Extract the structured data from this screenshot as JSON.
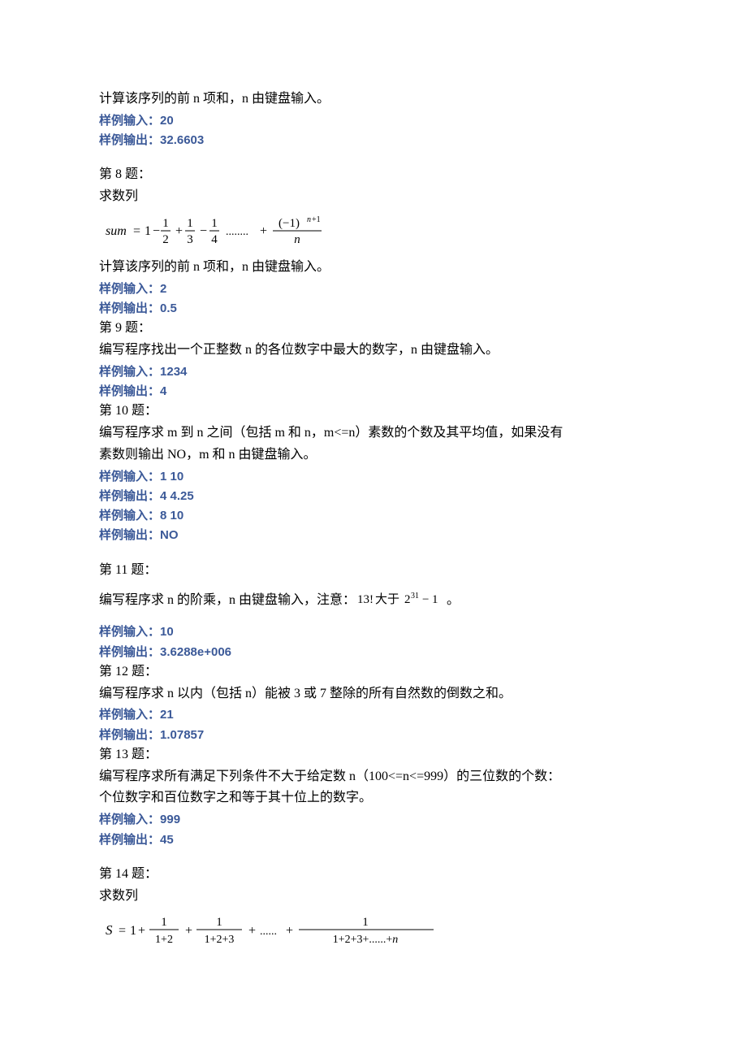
{
  "q7": {
    "desc": "计算该序列的前 n 项和，n 由键盘输入。",
    "in_label": "样例输入：",
    "in_val": "20",
    "out_label": "样例输出：",
    "out_val": "32.6603"
  },
  "q8": {
    "title": "第 8 题：",
    "subtitle": "求数列",
    "formula": "sum = 1 − 1/2 + 1/3 − 1/4 ........ + (−1)^(n+1) / n",
    "desc": "计算该序列的前 n 项和，n 由键盘输入。",
    "in_label": "样例输入：",
    "in_val": "2",
    "out_label": "样例输出：",
    "out_val": "0.5"
  },
  "q9": {
    "title": "第 9 题：",
    "desc": "编写程序找出一个正整数 n 的各位数字中最大的数字，n 由键盘输入。",
    "in_label": "样例输入：",
    "in_val": "1234",
    "out_label": "样例输出：",
    "out_val": "4"
  },
  "q10": {
    "title": "第 10 题：",
    "desc1": "编写程序求 m 到 n 之间（包括 m 和 n，m<=n）素数的个数及其平均值，如果没有",
    "desc2": "素数则输出 NO，m 和 n 由键盘输入。",
    "in_label1": "样例输入：",
    "in_val1": "1 10",
    "out_label1": "样例输出：",
    "out_val1": "4 4.25",
    "in_label2": "样例输入：",
    "in_val2": "8 10",
    "out_label2": "样例输出：",
    "out_val2": "NO"
  },
  "q11": {
    "title": "第 11 题：",
    "desc_pre": "编写程序求 n 的阶乘，n 由键盘输入，注意：",
    "desc_after": "。",
    "note": "13! 大于 2^31 − 1",
    "in_label": "样例输入：",
    "in_val": "10",
    "out_label": "样例输出：",
    "out_val": "3.6288e+006"
  },
  "q12": {
    "title": "第 12 题：",
    "desc": "编写程序求 n 以内（包括 n）能被 3 或 7 整除的所有自然数的倒数之和。",
    "in_label": "样例输入：",
    "in_val": "21",
    "out_label": "样例输出：",
    "out_val": "1.07857"
  },
  "q13": {
    "title": "第 13 题：",
    "desc1": "编写程序求所有满足下列条件不大于给定数 n（100<=n<=999）的三位数的个数：",
    "desc2": "个位数字和百位数字之和等于其十位上的数字。",
    "in_label": "样例输入：",
    "in_val": "999",
    "out_label": "样例输出：",
    "out_val": "45"
  },
  "q14": {
    "title": "第 14 题：",
    "subtitle": "求数列",
    "formula": "S = 1 + 1/(1+2) + 1/(1+2+3) + ...... + 1/(1+2+3+......+n)"
  }
}
